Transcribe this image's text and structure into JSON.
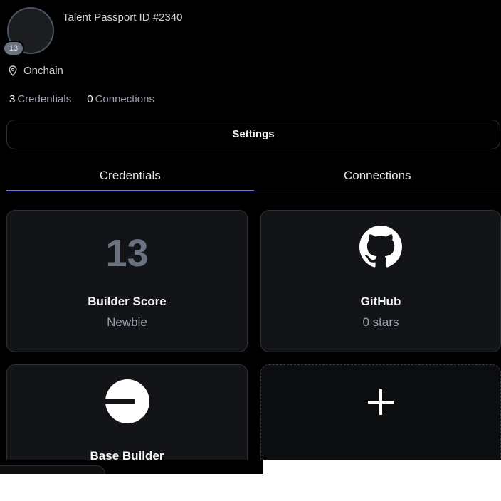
{
  "profile": {
    "passport_id": "Talent Passport ID #2340",
    "avatar_badge": "13",
    "location": "Onchain",
    "credentials_count": "3",
    "credentials_label": "Credentials",
    "connections_count": "0",
    "connections_label": "Connections"
  },
  "settings_label": "Settings",
  "tabs": [
    {
      "label": "Credentials",
      "active": true
    },
    {
      "label": "Connections",
      "active": false
    }
  ],
  "cards": [
    {
      "kind": "score",
      "value": "13",
      "title": "Builder Score",
      "subtitle": "Newbie"
    },
    {
      "kind": "github",
      "icon": "github-icon",
      "title": "GitHub",
      "subtitle": "0 stars"
    },
    {
      "kind": "base",
      "icon": "base-logo-icon",
      "title": "Base Builder"
    },
    {
      "kind": "add",
      "icon": "plus-icon"
    }
  ],
  "colors": {
    "background": "#000000",
    "card": "#131417",
    "accent": "#7c6cf0",
    "muted": "#9ca3af"
  }
}
